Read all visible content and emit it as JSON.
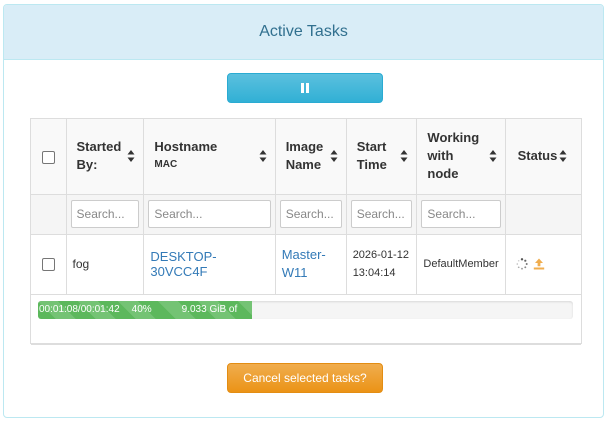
{
  "panel": {
    "title": "Active Tasks"
  },
  "buttons": {
    "pause_icon": "pause-icon",
    "cancel_label": "Cancel selected tasks?"
  },
  "table": {
    "columns": [
      {
        "label": "Started By:",
        "sub": ""
      },
      {
        "label": "Hostname",
        "sub": "MAC"
      },
      {
        "label": "Image Name",
        "sub": ""
      },
      {
        "label": "Start Time",
        "sub": ""
      },
      {
        "label": "Working with node",
        "sub": ""
      },
      {
        "label": "Status",
        "sub": ""
      }
    ],
    "filters": [
      "Search...",
      "Search...",
      "Search...",
      "Search...",
      "Search..."
    ],
    "rows": [
      {
        "started_by": "fog",
        "hostname": "DESKTOP-30VCC4F",
        "image_name_1": "Master-",
        "image_name_2": "W11",
        "start_date": "2026-01-12",
        "start_time": "13:04:14",
        "node": "DefaultMember",
        "status_icons": [
          "spinner-icon",
          "upload-icon"
        ],
        "progress": {
          "time": "00:01:08/00:01:42",
          "percent_label": "40%",
          "size": "9.033 GiB of",
          "fraction": 0.4
        }
      }
    ]
  },
  "colors": {
    "heading_bg": "#d9edf7",
    "heading_text": "#31708f",
    "pause_button": "#5bc0de",
    "cancel_button": "#f0ad4e",
    "progress_fill": "#5cb85c",
    "link": "#337ab7",
    "upload_icon": "#f0ad4e"
  }
}
